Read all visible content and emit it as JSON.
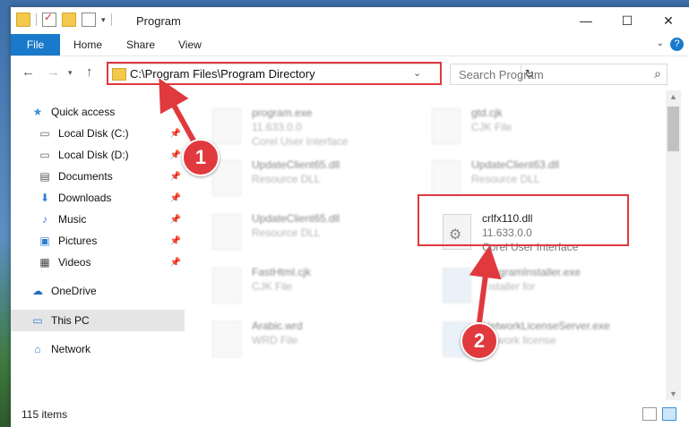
{
  "window": {
    "title": "Program",
    "controls": {
      "minimize": "—",
      "maximize": "☐",
      "close": "✕"
    }
  },
  "ribbon": {
    "tabs": [
      "File",
      "Home",
      "Share",
      "View"
    ],
    "help": "?"
  },
  "navigation": {
    "address": "C:\\Program Files\\Program Directory",
    "search_placeholder": "Search Program"
  },
  "sidebar": {
    "items": [
      {
        "label": "Quick access",
        "icon": "star-icon",
        "pinned": false
      },
      {
        "label": "Local Disk (C:)",
        "icon": "drive-icon",
        "pinned": true
      },
      {
        "label": "Local Disk (D:)",
        "icon": "drive-icon",
        "pinned": true
      },
      {
        "label": "Documents",
        "icon": "documents-icon",
        "pinned": true
      },
      {
        "label": "Downloads",
        "icon": "download-icon",
        "pinned": true
      },
      {
        "label": "Music",
        "icon": "music-icon",
        "pinned": true
      },
      {
        "label": "Pictures",
        "icon": "pictures-icon",
        "pinned": true
      },
      {
        "label": "Videos",
        "icon": "videos-icon",
        "pinned": true
      },
      {
        "label": "OneDrive",
        "icon": "cloud-icon",
        "pinned": false
      },
      {
        "label": "This PC",
        "icon": "computer-icon",
        "pinned": false,
        "selected": true
      },
      {
        "label": "Network",
        "icon": "network-icon",
        "pinned": false
      }
    ]
  },
  "files": [
    {
      "name": "program.exe",
      "type": "11.633.0.0",
      "desc": "Corel User Interface"
    },
    {
      "name": "gtd.cjk",
      "type": "CJK File",
      "desc": ""
    },
    {
      "name": "UpdateClient65.dll",
      "type": "Resource DLL",
      "desc": ""
    },
    {
      "name": "UpdateClient63.dll",
      "type": "Resource DLL",
      "desc": ""
    },
    {
      "name": "UpdateClient65.dll",
      "type": "Resource DLL",
      "desc": ""
    },
    {
      "name": "crlfx110.dll",
      "type": "11.633.0.0",
      "desc": "Corel User Interface",
      "highlighted": true
    },
    {
      "name": "FastHtml.cjk",
      "type": "CJK File",
      "desc": ""
    },
    {
      "name": "ProgramInstaller.exe",
      "type": "Installer for",
      "desc": ""
    },
    {
      "name": "Arabic.wrd",
      "type": "WRD File",
      "desc": ""
    },
    {
      "name": "NetworkLicenseServer.exe",
      "type": "network license",
      "desc": ""
    }
  ],
  "status": {
    "item_count": "115 items"
  },
  "callouts": [
    "1",
    "2"
  ],
  "colors": {
    "accent": "#1979ca",
    "callout": "#e0393e",
    "selected_bg": "#e5e5e5"
  }
}
